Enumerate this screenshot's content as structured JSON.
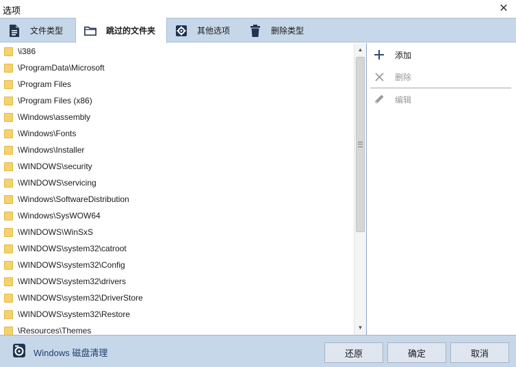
{
  "window": {
    "title": "选项"
  },
  "tabs": [
    {
      "label": "文件类型",
      "icon": "document-icon",
      "active": false
    },
    {
      "label": "跳过的文件夹",
      "icon": "folder-outline-icon",
      "active": true
    },
    {
      "label": "其他选项",
      "icon": "gear-icon",
      "active": false
    },
    {
      "label": "删除类型",
      "icon": "trash-icon",
      "active": false
    }
  ],
  "folders": [
    "\\i386",
    "\\ProgramData\\Microsoft",
    "\\Program Files",
    "\\Program Files (x86)",
    "\\Windows\\assembly",
    "\\Windows\\Fonts",
    "\\Windows\\Installer",
    "\\WINDOWS\\security",
    "\\WINDOWS\\servicing",
    "\\Windows\\SoftwareDistribution",
    "\\Windows\\SysWOW64",
    "\\WINDOWS\\WinSxS",
    "\\WINDOWS\\system32\\catroot",
    "\\WINDOWS\\system32\\Config",
    "\\WINDOWS\\system32\\drivers",
    "\\WINDOWS\\system32\\DriverStore",
    "\\WINDOWS\\system32\\Restore",
    "\\Resources\\Themes"
  ],
  "actions": {
    "add": {
      "label": "添加",
      "icon": "plus-icon"
    },
    "delete": {
      "label": "删除",
      "icon": "x-icon"
    },
    "edit": {
      "label": "编辑",
      "icon": "pencil-icon"
    }
  },
  "footer": {
    "app_name": "Windows 磁盘清理",
    "restore_label": "还原",
    "ok_label": "确定",
    "cancel_label": "取消"
  },
  "colors": {
    "tabbar_bg": "#c7d7ea",
    "footer_bg": "#c7d7ea",
    "folder_fill": "#f6d36a",
    "accent": "#1f3f66"
  }
}
